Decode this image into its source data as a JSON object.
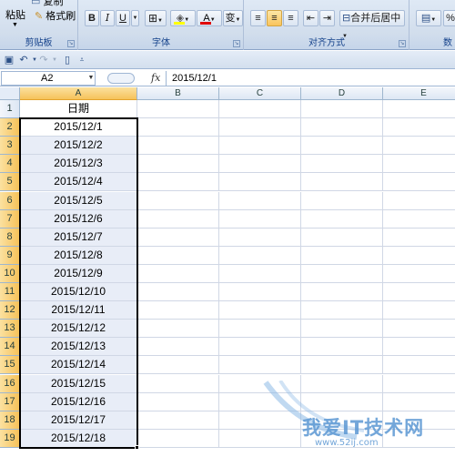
{
  "ribbon": {
    "clipboard": {
      "paste_label": "粘贴",
      "copy_label": "复制",
      "format_painter_label": "格式刷",
      "group_label": "剪贴板"
    },
    "font": {
      "bold_label": "B",
      "italic_label": "I",
      "underline_label": "U",
      "font_color_label": "A",
      "phonetic_label": "变",
      "group_label": "字体"
    },
    "alignment": {
      "merge_center_label": "合并后居中",
      "group_label": "对齐方式"
    },
    "number": {
      "group_label": "数"
    }
  },
  "name_box": {
    "value": "A2"
  },
  "formula_bar": {
    "fx_label": "fx",
    "value": "2015/12/1"
  },
  "columns": [
    "A",
    "B",
    "C",
    "D",
    "E"
  ],
  "rows": [
    "1",
    "2",
    "3",
    "4",
    "5",
    "6",
    "7",
    "8",
    "9",
    "10",
    "11",
    "12",
    "13",
    "14",
    "15",
    "16",
    "17",
    "18",
    "19"
  ],
  "column_a": [
    "日期",
    "2015/12/1",
    "2015/12/2",
    "2015/12/3",
    "2015/12/4",
    "2015/12/5",
    "2015/12/6",
    "2015/12/7",
    "2015/12/8",
    "2015/12/9",
    "2015/12/10",
    "2015/12/11",
    "2015/12/12",
    "2015/12/13",
    "2015/12/14",
    "2015/12/15",
    "2015/12/16",
    "2015/12/17",
    "2015/12/18"
  ],
  "watermark": {
    "text": "我爱IT技术网",
    "url": "www.52ij.com"
  },
  "colors": {
    "selection_header": "#f6c25a",
    "range_fill": "#e8edf7",
    "ribbon": "#d1ddec"
  }
}
